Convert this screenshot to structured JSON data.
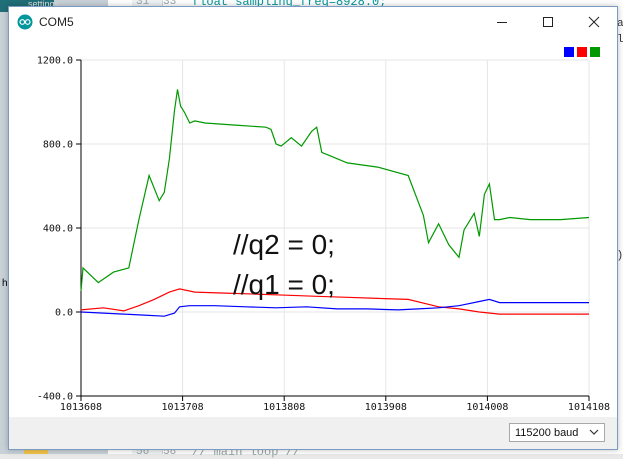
{
  "background_editor": {
    "top_strip_text": "settings",
    "line_number_top_a": "31",
    "line_number_top_b": "33",
    "code_top": "float sampling_freq=8928.0;",
    "line_number_bottom_a": "56",
    "line_number_bottom_b": "58",
    "code_bottom": "// main loop //",
    "right_text_1": "a",
    "right_text_2": "l",
    "right_text_3": "q)",
    "left_letter": "h"
  },
  "window": {
    "title": "COM5",
    "minimize_icon": "minimize-icon",
    "maximize_icon": "maximize-icon",
    "close_icon": "close-icon"
  },
  "legend": [
    {
      "color": "#0000ff",
      "name": "series-blue"
    },
    {
      "color": "#ff0000",
      "name": "series-red"
    },
    {
      "color": "#009900",
      "name": "series-green"
    }
  ],
  "overlay_text": {
    "line1": "//q2 = 0;",
    "line2": "//q1 = 0;"
  },
  "baud": {
    "selected": "115200 baud"
  },
  "chart_data": {
    "type": "line",
    "x_ticks": [
      "1013608",
      "1013708",
      "1013808",
      "1013908",
      "1014008",
      "1014108"
    ],
    "y_ticks": [
      "1200.0",
      "800.0",
      "400.0",
      "0.0",
      "-400.0"
    ],
    "xlim": [
      1013608,
      1014108
    ],
    "ylim": [
      -400,
      1200
    ],
    "grid": true,
    "series": [
      {
        "color": "#009900",
        "x": [
          1013608,
          1013610,
          1013625,
          1013640,
          1013655,
          1013665,
          1013675,
          1013685,
          1013690,
          1013695,
          1013700,
          1013703,
          1013706,
          1013710,
          1013715,
          1013720,
          1013730,
          1013760,
          1013790,
          1013795,
          1013800,
          1013805,
          1013815,
          1013825,
          1013835,
          1013840,
          1013845,
          1013855,
          1013870,
          1013900,
          1013930,
          1013945,
          1013950,
          1013960,
          1013970,
          1013980,
          1013985,
          1013995,
          1014000,
          1014005,
          1014010,
          1014015,
          1014020,
          1014030,
          1014050,
          1014080,
          1014108
        ],
        "values": [
          100,
          210,
          140,
          190,
          210,
          440,
          650,
          530,
          570,
          730,
          960,
          1060,
          980,
          950,
          900,
          910,
          900,
          890,
          880,
          870,
          800,
          790,
          830,
          790,
          860,
          880,
          760,
          740,
          710,
          690,
          650,
          460,
          330,
          420,
          320,
          260,
          390,
          470,
          360,
          560,
          610,
          440,
          440,
          450,
          440,
          440,
          450
        ]
      },
      {
        "color": "#ff0000",
        "x": [
          1013608,
          1013630,
          1013650,
          1013665,
          1013680,
          1013695,
          1013705,
          1013720,
          1013750,
          1013780,
          1013810,
          1013840,
          1013870,
          1013900,
          1013930,
          1013960,
          1013980,
          1014000,
          1014020,
          1014050,
          1014080,
          1014108
        ],
        "values": [
          10,
          20,
          5,
          30,
          60,
          95,
          110,
          95,
          90,
          85,
          80,
          75,
          70,
          65,
          60,
          25,
          15,
          0,
          -10,
          -10,
          -10,
          -10
        ]
      },
      {
        "color": "#0000ff",
        "x": [
          1013608,
          1013630,
          1013650,
          1013670,
          1013690,
          1013700,
          1013705,
          1013715,
          1013740,
          1013770,
          1013800,
          1013830,
          1013860,
          1013890,
          1013920,
          1013940,
          1013960,
          1013980,
          1014000,
          1014010,
          1014020,
          1014050,
          1014080,
          1014108
        ],
        "values": [
          0,
          -5,
          -10,
          -15,
          -20,
          -5,
          25,
          30,
          30,
          25,
          20,
          25,
          15,
          15,
          10,
          15,
          20,
          30,
          50,
          60,
          45,
          45,
          45,
          45
        ]
      }
    ]
  }
}
